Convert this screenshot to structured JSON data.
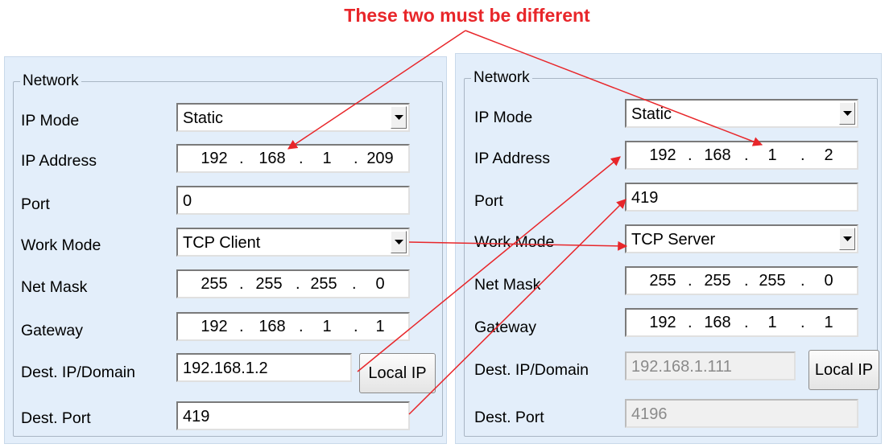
{
  "annotation": {
    "title": "These two must be different",
    "color": "#e8262a"
  },
  "panels": {
    "left": {
      "legend": "Network",
      "labels": {
        "ip_mode": "IP Mode",
        "ip_address": "IP Address",
        "port": "Port",
        "work_mode": "Work Mode",
        "net_mask": "Net Mask",
        "gateway": "Gateway",
        "dest_ip": "Dest. IP/Domain",
        "dest_port": "Dest. Port"
      },
      "ip_mode": "Static",
      "ip_address": [
        "192",
        "168",
        "1",
        "209"
      ],
      "port": "0",
      "work_mode": "TCP Client",
      "net_mask": [
        "255",
        "255",
        "255",
        "0"
      ],
      "gateway": [
        "192",
        "168",
        "1",
        "1"
      ],
      "dest_ip": "192.168.1.2",
      "dest_port": "419",
      "local_ip_button": "Local IP"
    },
    "right": {
      "legend": "Network",
      "labels": {
        "ip_mode": "IP Mode",
        "ip_address": "IP Address",
        "port": "Port",
        "work_mode": "Work Mode",
        "net_mask": "Net Mask",
        "gateway": "Gateway",
        "dest_ip": "Dest. IP/Domain",
        "dest_port": "Dest. Port"
      },
      "ip_mode": "Static",
      "ip_address": [
        "192",
        "168",
        "1",
        "2"
      ],
      "port": "419",
      "work_mode": "TCP Server",
      "net_mask": [
        "255",
        "255",
        "255",
        "0"
      ],
      "gateway": [
        "192",
        "168",
        "1",
        "1"
      ],
      "dest_ip": "192.168.1.111",
      "dest_port": "4196",
      "local_ip_button": "Local IP",
      "dest_fields_disabled": true
    }
  },
  "icons": {
    "dropdown": "chevron-down-icon",
    "annotation_arrow": "red-arrow-icon"
  }
}
